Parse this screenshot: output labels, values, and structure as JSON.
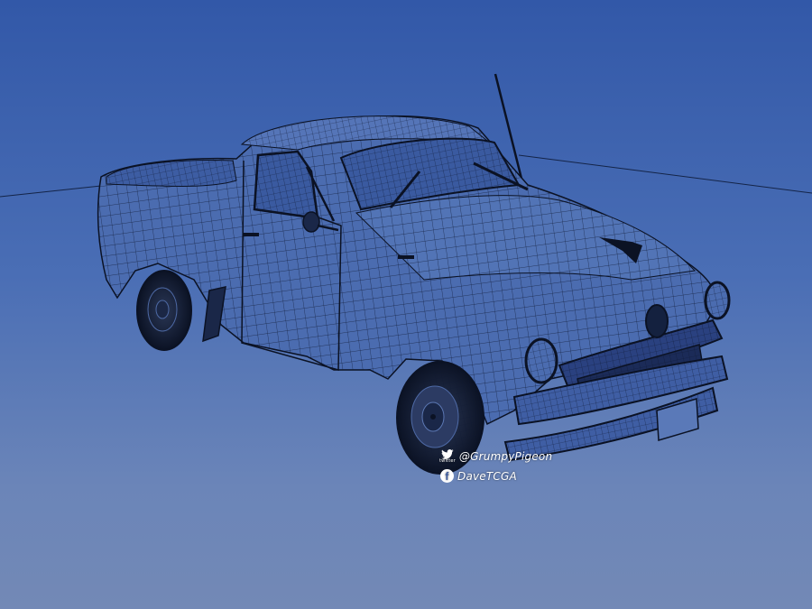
{
  "scene": {
    "subject": "wireframe-pickup-truck",
    "background_top": "#3258a8",
    "background_bottom": "#7389b6",
    "wire_color": "#0d1830",
    "body_fill": "#4b6cb0"
  },
  "credits": {
    "twitter_handle": "@GrumpyPigeon",
    "twitter_word": "twitter",
    "facebook_name": "DaveTCGA",
    "twitter_icon": "twitter-bird-icon",
    "facebook_icon": "facebook-icon"
  }
}
